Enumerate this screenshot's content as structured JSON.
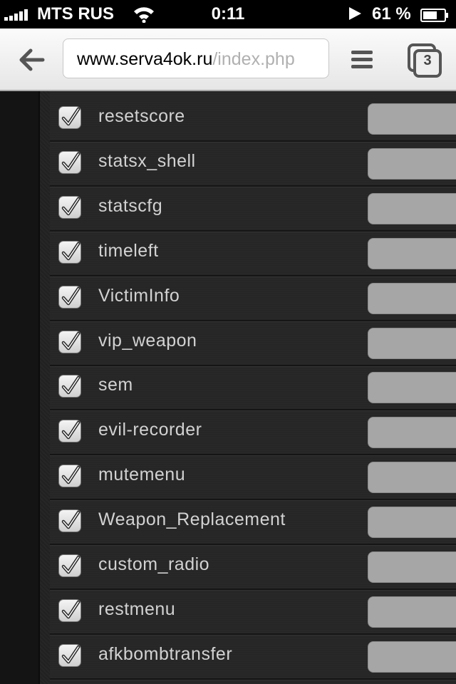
{
  "status_bar": {
    "carrier": "MTS RUS",
    "time": "0:11",
    "battery": "61 %"
  },
  "browser": {
    "url_host": "www.serva4ok.ru",
    "url_path": "/index.php",
    "tab_count": "3"
  },
  "plugins": [
    {
      "name": "resetscore",
      "checked": true
    },
    {
      "name": "statsx_shell",
      "checked": true
    },
    {
      "name": "statscfg",
      "checked": true
    },
    {
      "name": "timeleft",
      "checked": true
    },
    {
      "name": "VictimInfo",
      "checked": true
    },
    {
      "name": "vip_weapon",
      "checked": true
    },
    {
      "name": "sem",
      "checked": true
    },
    {
      "name": "evil-recorder",
      "checked": true
    },
    {
      "name": "mutemenu",
      "checked": true
    },
    {
      "name": "Weapon_Replacement",
      "checked": true
    },
    {
      "name": "custom_radio",
      "checked": true
    },
    {
      "name": "restmenu",
      "checked": true
    },
    {
      "name": "afkbombtransfer",
      "checked": true
    }
  ],
  "colors": {
    "row_text": "#d2d2d2",
    "field_bg": "#a6a6a6",
    "url_path": "#b0b0b0"
  }
}
